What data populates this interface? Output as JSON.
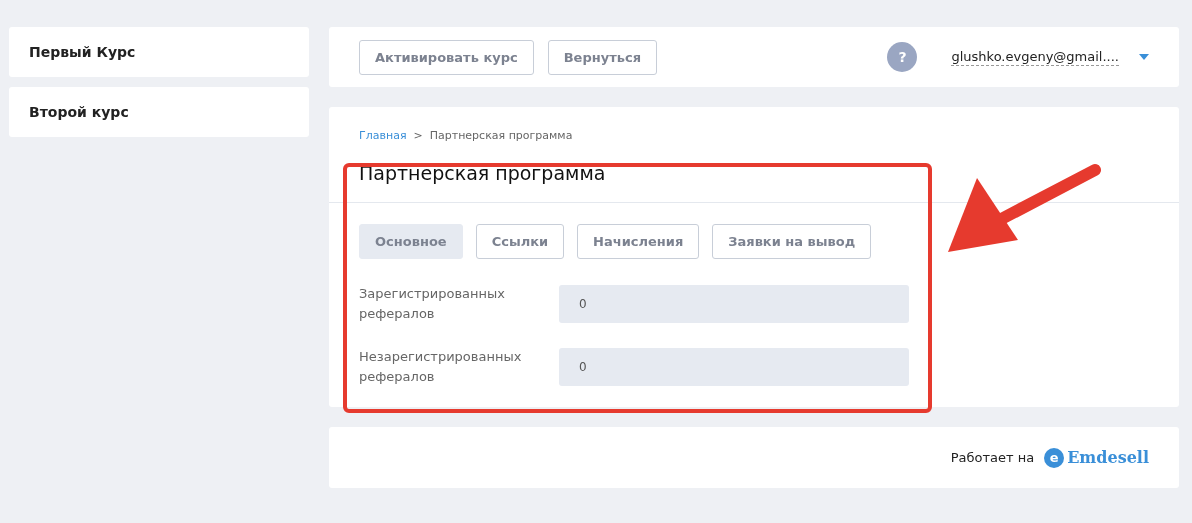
{
  "sidebar": {
    "items": [
      {
        "label": "Первый Курс"
      },
      {
        "label": "Второй курс"
      }
    ]
  },
  "topbar": {
    "buttons": [
      "Активировать курс",
      "Вернуться"
    ],
    "help": "?",
    "user": "glushko.evgeny@gmail...."
  },
  "breadcrumb": [
    {
      "label": "Главная",
      "link": true
    },
    {
      "label": ">",
      "link": false
    },
    {
      "label": "Партнерская программа",
      "link": false
    }
  ],
  "title": "Партнерская программа",
  "tabs": [
    {
      "label": "Основное",
      "selected": true
    },
    {
      "label": "Ссылки",
      "selected": false
    },
    {
      "label": "Начисления",
      "selected": false
    },
    {
      "label": "Заявки на вывод",
      "selected": false
    }
  ],
  "fields": [
    {
      "label": "Зарегистрированных рефералов",
      "value": "0"
    },
    {
      "label": "Незарегистрированных рефералов",
      "value": "0"
    }
  ],
  "footer": {
    "text": "Работает на",
    "logo_mark": "e",
    "logo_text": "Emdesell"
  }
}
